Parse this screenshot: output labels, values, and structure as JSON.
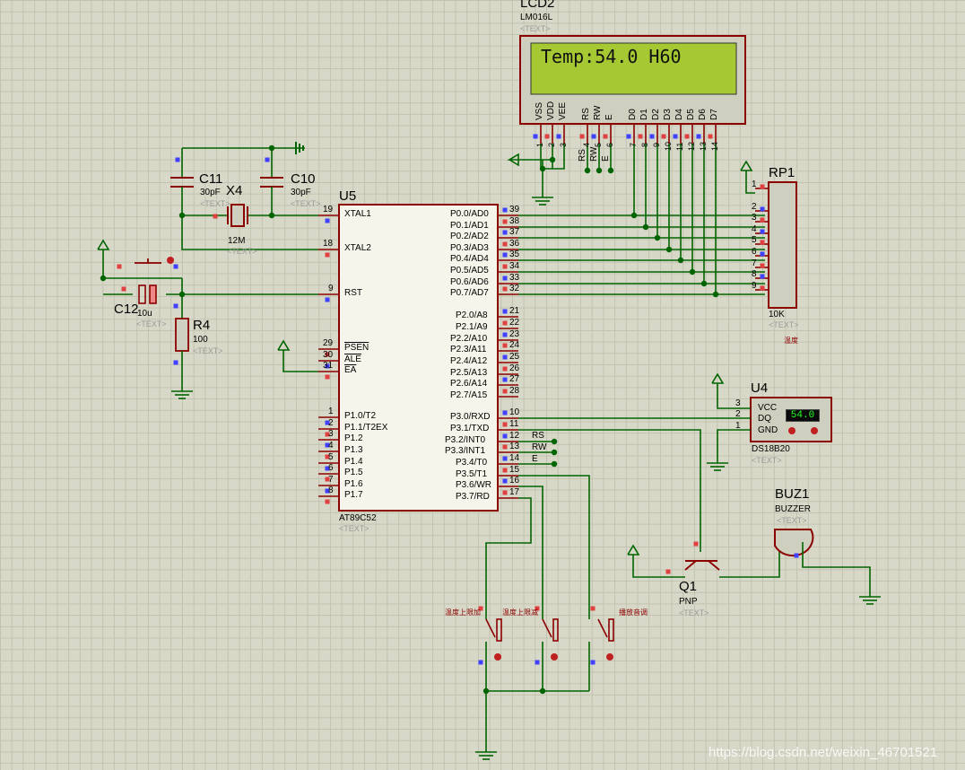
{
  "lcd": {
    "ref": "LCD2",
    "model": "LM016L",
    "text_tag": "<TEXT>",
    "display_text": "Temp:54.0 H60",
    "pins": [
      "VSS",
      "VDD",
      "VEE",
      "RS",
      "RW",
      "E",
      "D0",
      "D1",
      "D2",
      "D3",
      "D4",
      "D5",
      "D6",
      "D7"
    ],
    "pin_numbers": [
      "1",
      "2",
      "3",
      "4",
      "5",
      "6",
      "7",
      "8",
      "9",
      "10",
      "11",
      "12",
      "13",
      "14"
    ]
  },
  "mcu": {
    "ref": "U5",
    "model": "AT89C52",
    "text_tag": "<TEXT>",
    "left_pins": [
      {
        "num": "19",
        "name": "XTAL1"
      },
      {
        "num": "18",
        "name": "XTAL2"
      },
      {
        "num": "9",
        "name": "RST"
      },
      {
        "num": "29",
        "name": "PSEN"
      },
      {
        "num": "30",
        "name": "ALE"
      },
      {
        "num": "31",
        "name": "EA"
      },
      {
        "num": "1",
        "name": "P1.0/T2"
      },
      {
        "num": "2",
        "name": "P1.1/T2EX"
      },
      {
        "num": "3",
        "name": "P1.2"
      },
      {
        "num": "4",
        "name": "P1.3"
      },
      {
        "num": "5",
        "name": "P1.4"
      },
      {
        "num": "6",
        "name": "P1.5"
      },
      {
        "num": "7",
        "name": "P1.6"
      },
      {
        "num": "8",
        "name": "P1.7"
      }
    ],
    "right_pins": [
      {
        "num": "39",
        "name": "P0.0/AD0"
      },
      {
        "num": "38",
        "name": "P0.1/AD1"
      },
      {
        "num": "37",
        "name": "P0.2/AD2"
      },
      {
        "num": "36",
        "name": "P0.3/AD3"
      },
      {
        "num": "35",
        "name": "P0.4/AD4"
      },
      {
        "num": "34",
        "name": "P0.5/AD5"
      },
      {
        "num": "33",
        "name": "P0.6/AD6"
      },
      {
        "num": "32",
        "name": "P0.7/AD7"
      },
      {
        "num": "21",
        "name": "P2.0/A8"
      },
      {
        "num": "22",
        "name": "P2.1/A9"
      },
      {
        "num": "23",
        "name": "P2.2/A10"
      },
      {
        "num": "24",
        "name": "P2.3/A11"
      },
      {
        "num": "25",
        "name": "P2.4/A12"
      },
      {
        "num": "26",
        "name": "P2.5/A13"
      },
      {
        "num": "27",
        "name": "P2.6/A14"
      },
      {
        "num": "28",
        "name": "P2.7/A15"
      },
      {
        "num": "10",
        "name": "P3.0/RXD"
      },
      {
        "num": "11",
        "name": "P3.1/TXD"
      },
      {
        "num": "12",
        "name": "P3.2/INT0"
      },
      {
        "num": "13",
        "name": "P3.3/INT1"
      },
      {
        "num": "14",
        "name": "P3.4/T0"
      },
      {
        "num": "15",
        "name": "P3.5/T1"
      },
      {
        "num": "16",
        "name": "P3.6/WR"
      },
      {
        "num": "17",
        "name": "P3.7/RD"
      }
    ],
    "net_labels": [
      "RS",
      "RW",
      "E"
    ]
  },
  "c11": {
    "ref": "C11",
    "value": "30pF",
    "text_tag": "<TEXT>"
  },
  "c10": {
    "ref": "C10",
    "value": "30pF",
    "text_tag": "<TEXT>"
  },
  "x4": {
    "ref": "X4",
    "value": "12M",
    "text_tag": "<TEXT>"
  },
  "c12": {
    "ref": "C12",
    "value": "10u",
    "text_tag": "<TEXT>"
  },
  "r4": {
    "ref": "R4",
    "value": "100",
    "text_tag": "<TEXT>"
  },
  "rp1": {
    "ref": "RP1",
    "value": "10K",
    "text_tag": "<TEXT>",
    "note": "温度",
    "pins": [
      "1",
      "2",
      "3",
      "4",
      "5",
      "6",
      "7",
      "8",
      "9"
    ]
  },
  "u4": {
    "ref": "U4",
    "model": "DS18B20",
    "text_tag": "<TEXT>",
    "reading": "54.0",
    "pins": [
      {
        "num": "3",
        "name": "VCC"
      },
      {
        "num": "2",
        "name": "DQ"
      },
      {
        "num": "1",
        "name": "GND"
      }
    ]
  },
  "buz1": {
    "ref": "BUZ1",
    "model": "BUZZER",
    "text_tag": "<TEXT>"
  },
  "q1": {
    "ref": "Q1",
    "model": "PNP",
    "text_tag": "<TEXT>"
  },
  "buttons": [
    {
      "label": "温度上限加"
    },
    {
      "label": "温度上限减"
    },
    {
      "label": "播放音调"
    }
  ],
  "lcd_net_labels": [
    "RS",
    "RW",
    "E"
  ],
  "watermark": "https://blog.csdn.net/weixin_46701521",
  "colors": {
    "wire": "#006400",
    "body": "#8b0000",
    "chip_fill": "#f5f5eb",
    "lcd_green": "#a6c832",
    "pin_red": "#e0403f",
    "pin_blue": "#4040ff"
  }
}
